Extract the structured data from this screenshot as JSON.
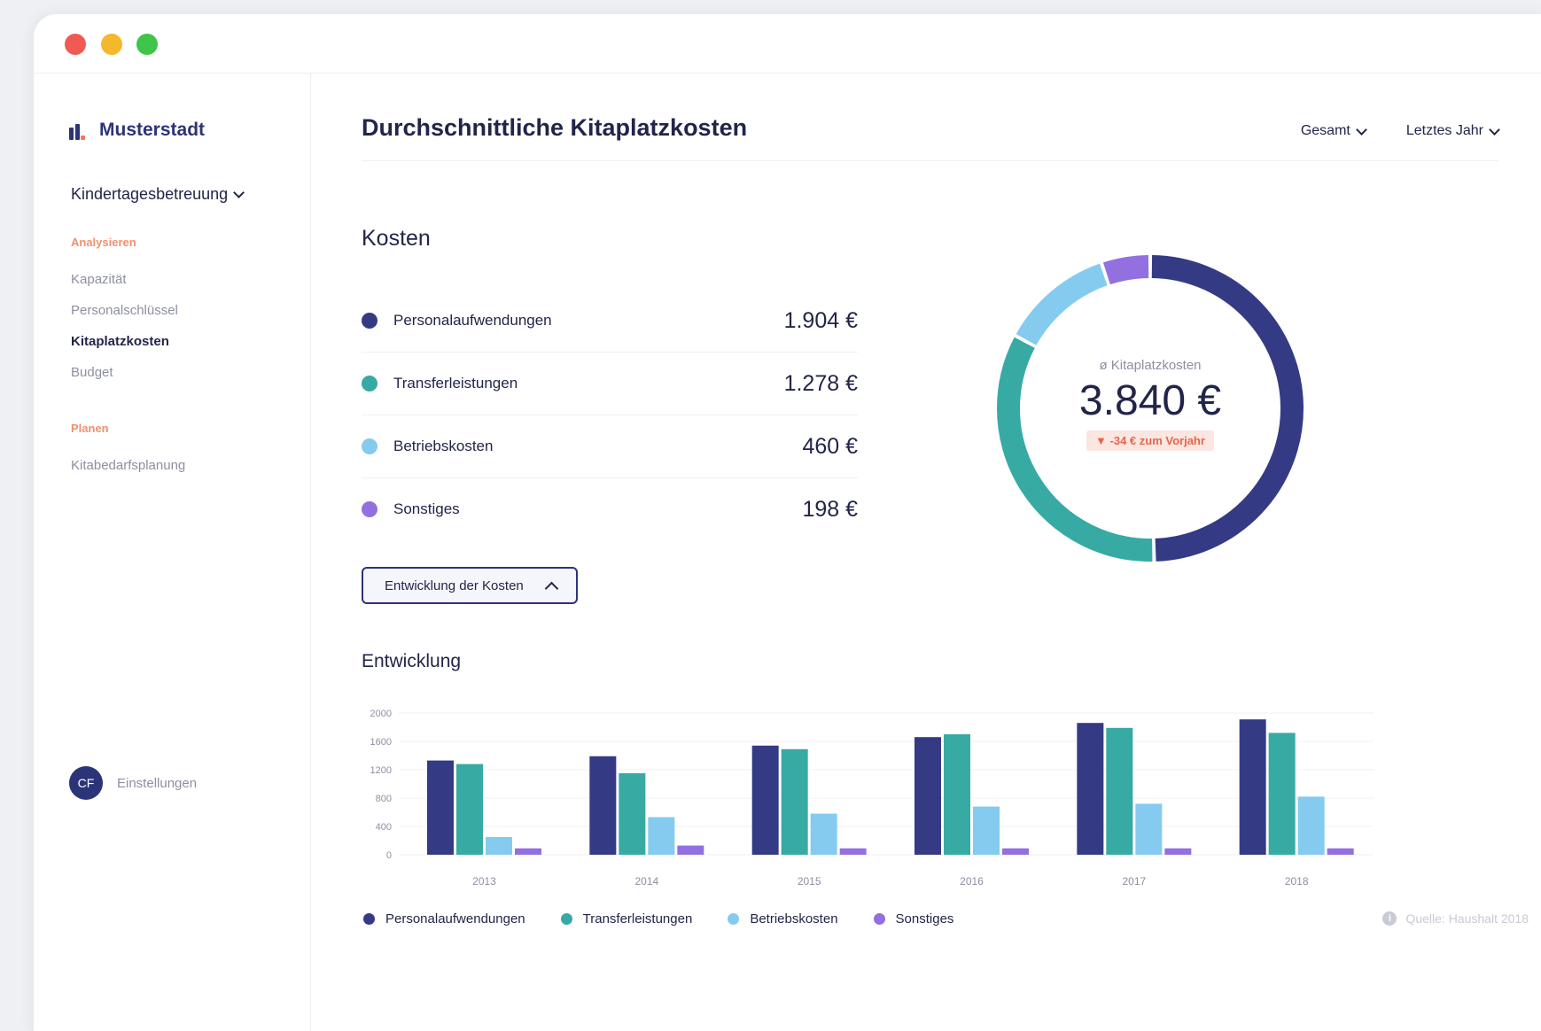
{
  "colors": {
    "personal": "#343b84",
    "transfer": "#37aaa4",
    "betrieb": "#84cbef",
    "sonstiges": "#9270e0"
  },
  "sidebar": {
    "brand": "Musterstadt",
    "area": "Kindertagesbetreuung",
    "section_analyze": "Analysieren",
    "items_analyze": [
      "Kapazität",
      "Personalschlüssel",
      "Kitaplatzkosten",
      "Budget"
    ],
    "section_plan": "Planen",
    "items_plan": [
      "Kitabedarfsplanung"
    ],
    "user_initials": "CF",
    "settings_label": "Einstellungen"
  },
  "header": {
    "title": "Durchschnittliche Kitaplatzkosten",
    "filter_scope": "Gesamt",
    "filter_period": "Letztes Jahr"
  },
  "kosten": {
    "title": "Kosten",
    "rows": [
      {
        "label": "Personalaufwendungen",
        "value": "1.904 €"
      },
      {
        "label": "Transferleistungen",
        "value": "1.278 €"
      },
      {
        "label": "Betriebskosten",
        "value": "460 €"
      },
      {
        "label": "Sonstiges",
        "value": "198 €"
      }
    ],
    "toggle_button": "Entwicklung der Kosten"
  },
  "donut": {
    "caption": "ø Kitaplatzkosten",
    "total": "3.840 €",
    "delta": "▼ -34 € zum Vorjahr"
  },
  "entwicklung": {
    "title": "Entwicklung",
    "source": "Quelle: Haushalt 2018"
  },
  "chart_data": [
    {
      "type": "pie",
      "categories": [
        "Personalaufwendungen",
        "Transferleistungen",
        "Betriebskosten",
        "Sonstiges"
      ],
      "values": [
        1904,
        1278,
        460,
        198
      ],
      "title": "ø Kitaplatzkosten"
    },
    {
      "type": "bar",
      "categories": [
        "2013",
        "2014",
        "2015",
        "2016",
        "2017",
        "2018"
      ],
      "series": [
        {
          "name": "Personalaufwendungen",
          "values": [
            1330,
            1390,
            1540,
            1660,
            1860,
            1910
          ]
        },
        {
          "name": "Transferleistungen",
          "values": [
            1280,
            1150,
            1490,
            1700,
            1790,
            1720
          ]
        },
        {
          "name": "Betriebskosten",
          "values": [
            250,
            530,
            580,
            680,
            720,
            820
          ]
        },
        {
          "name": "Sonstiges",
          "values": [
            90,
            130,
            90,
            90,
            90,
            90
          ]
        }
      ],
      "yticks": [
        "0",
        "400",
        "800",
        "1200",
        "1600",
        "2000"
      ],
      "ylim": [
        0,
        2000
      ],
      "grid": true,
      "legend": "bottom"
    }
  ]
}
